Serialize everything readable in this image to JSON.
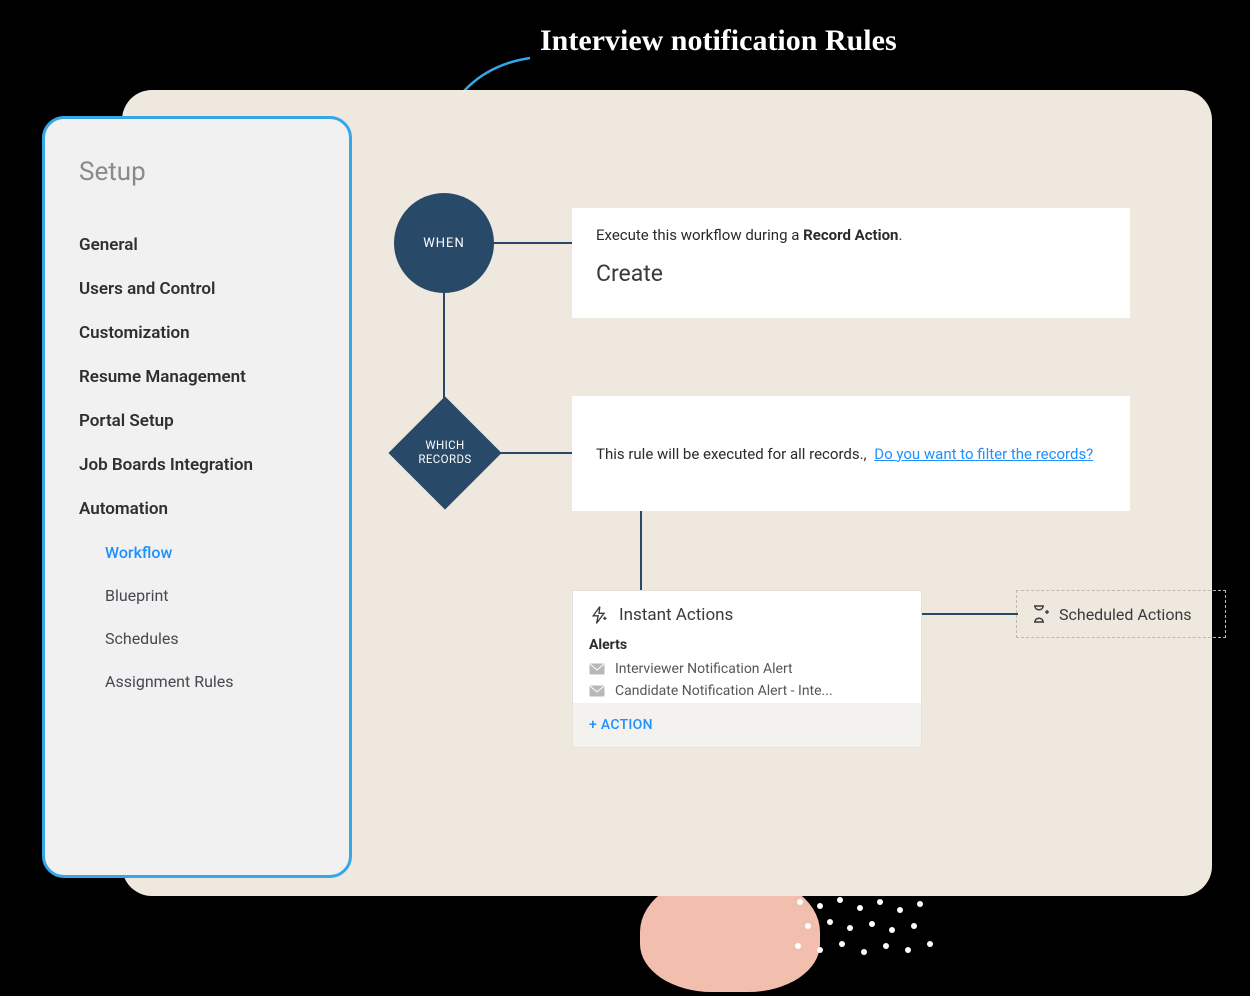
{
  "annotation": "Interview notification Rules",
  "sidebar": {
    "title": "Setup",
    "items": [
      "General",
      "Users and Control",
      "Customization",
      "Resume Management",
      "Portal Setup",
      "Job Boards Integration",
      "Automation"
    ],
    "sub": {
      "workflow": "Workflow",
      "blueprint": "Blueprint",
      "schedules": "Schedules",
      "assignment": "Assignment Rules"
    }
  },
  "workflow": {
    "when": {
      "node": "WHEN",
      "line1_pre": "Execute this workflow during a ",
      "line1_bold": "Record Action",
      "line1_post": ".",
      "line2": "Create"
    },
    "which": {
      "node_l1": "WHICH",
      "node_l2": "RECORDS",
      "text": "This rule will be executed for all records.,",
      "link": "Do you want to filter the records?"
    },
    "actions": {
      "instant_title": "Instant Actions",
      "alerts_title": "Alerts",
      "alerts": [
        "Interviewer Notification Alert",
        "Candidate Notification Alert - Inte..."
      ],
      "add": "+ ACTION",
      "scheduled_title": "Scheduled Actions"
    }
  }
}
